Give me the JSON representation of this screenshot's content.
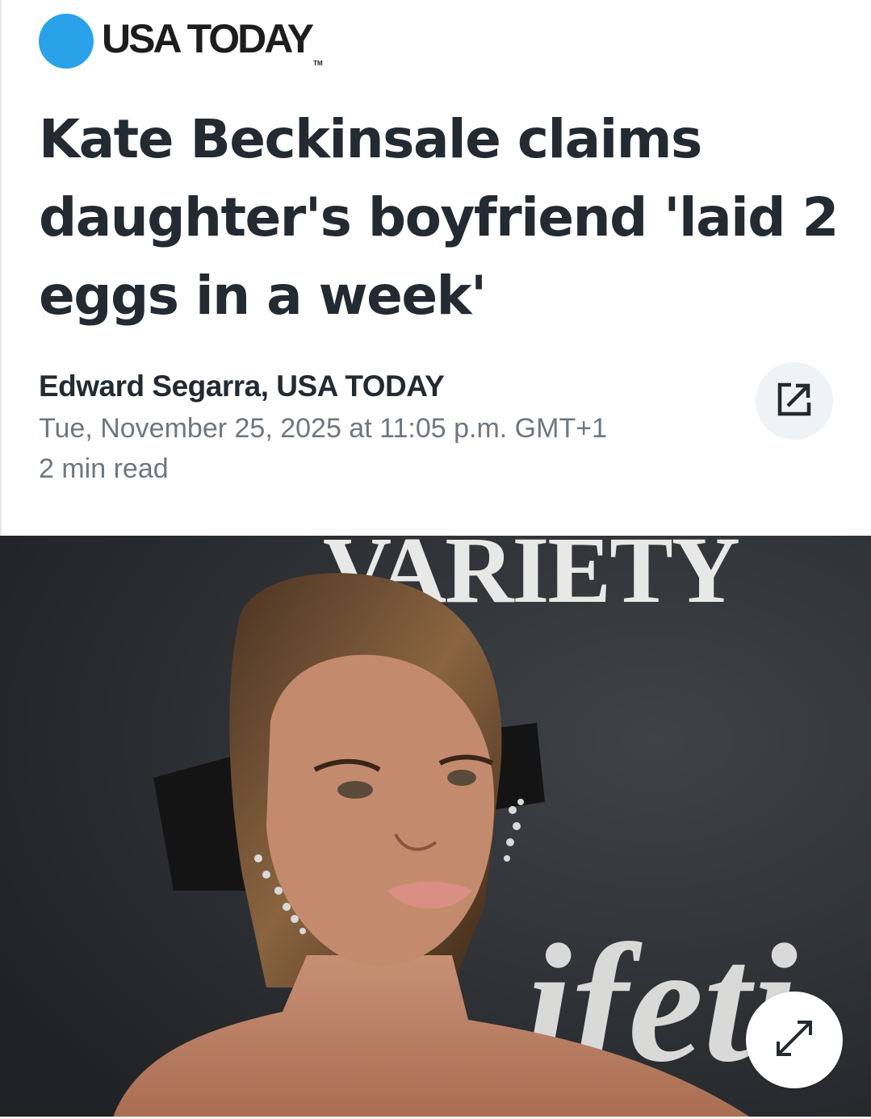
{
  "brand": {
    "name": "USA TODAY",
    "trademark": "TM",
    "dot_color": "#2aa2ea"
  },
  "article": {
    "headline": "Kate Beckinsale claims daughter's boyfriend 'laid 2 eggs in a week'",
    "byline": "Edward Segarra, USA TODAY",
    "timestamp": "Tue, November 25, 2025 at 11:05 p.m. GMT+1",
    "read_time": "2 min read"
  },
  "actions": {
    "share_icon": "external-share-icon",
    "expand_icon": "expand-arrows-icon"
  },
  "hero_image": {
    "backdrop_text_top": "VARIETY",
    "backdrop_text_bottom": "ifeti"
  }
}
